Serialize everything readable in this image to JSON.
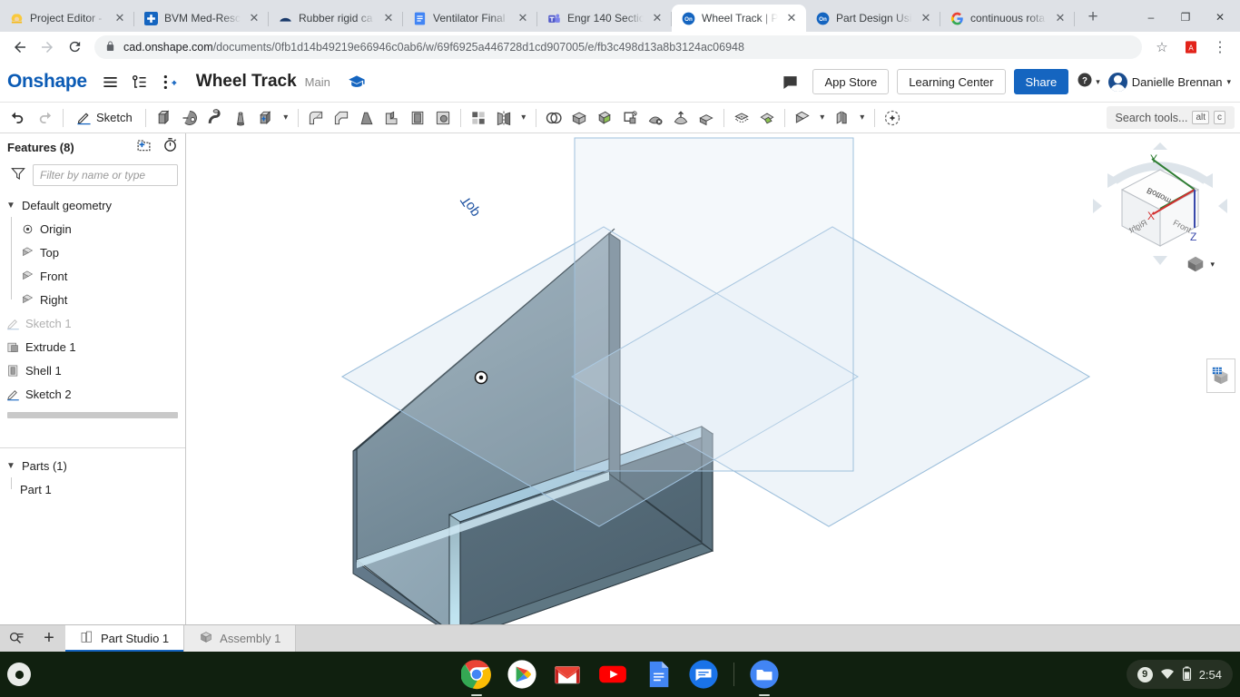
{
  "browser": {
    "tabs": [
      {
        "title": "Project Editor -",
        "favicon": "construction-worker-icon",
        "active": false
      },
      {
        "title": "BVM Med-Rescu",
        "favicon": "blue-plus-icon",
        "active": false
      },
      {
        "title": "Rubber rigid ca",
        "favicon": "dark-blue-shape-icon",
        "active": false
      },
      {
        "title": "Ventilator Final",
        "favicon": "google-docs-icon",
        "active": false
      },
      {
        "title": "Engr 140 Sectio",
        "favicon": "microsoft-teams-icon",
        "active": false
      },
      {
        "title": "Wheel Track | P",
        "favicon": "onshape-icon",
        "active": true
      },
      {
        "title": "Part Design Usi",
        "favicon": "onshape-icon",
        "active": false
      },
      {
        "title": "continuous rota",
        "favicon": "google-icon",
        "active": false
      }
    ],
    "new_tab_label": "+",
    "close_label": "✕",
    "window_controls": {
      "minimize": "–",
      "maximize": "❐",
      "close": "✕"
    },
    "nav": {
      "back": "←",
      "forward": "→",
      "reload": "⟳"
    },
    "url_host": "cad.onshape.com",
    "url_path": "/documents/0fb1d14b49219e66946c0ab6/w/69f6925a446728d1cd907005/e/fb3c498d13a8b3124ac06948",
    "lock_icon": "lock-icon",
    "star_icon": "☆",
    "pdf_icon": "A",
    "menu_icon": "⋮"
  },
  "onshape_header": {
    "logo": "Onshape",
    "menu_icon": "hamburger-menu-icon",
    "versions_icon": "version-graph-icon",
    "insert_icon": "branch-add-icon",
    "document_title": "Wheel Track",
    "branch": "Main",
    "graduation_icon": "graduation-cap-icon",
    "comment_icon": "comment-bubble-icon",
    "app_store_label": "App Store",
    "learning_center_label": "Learning Center",
    "share_label": "Share",
    "help_icon": "question-circle-icon",
    "caret": "▾",
    "user_name": "Danielle Brennan"
  },
  "toolbar": {
    "undo": "undo-arrow-icon",
    "redo": "redo-arrow-icon",
    "sketch_label": "Sketch",
    "tools": [
      "extrude-icon",
      "revolve-icon",
      "sweep-icon",
      "loft-icon",
      "thicken-icon",
      "fillet-icon",
      "chamfer-icon",
      "draft-icon",
      "rib-icon",
      "shell-icon",
      "hole-icon",
      "linear-pattern-icon",
      "mirror-icon",
      "boolean-icon",
      "enclose-icon",
      "split-icon",
      "transform-icon",
      "delete-face-icon",
      "move-face-icon",
      "delete-part-icon",
      "offset-surface-icon",
      "fill-surface-icon",
      "plane-icon",
      "sheet-metal-icon",
      "variable-icon"
    ],
    "search_placeholder": "Search tools...",
    "kbd_alt": "alt",
    "kbd_c": "c"
  },
  "features_panel": {
    "title": "Features (8)",
    "add_folder_icon": "add-folder-icon",
    "history_icon": "stopwatch-icon",
    "filter_icon": "funnel-icon",
    "filter_placeholder": "Filter by name or type",
    "default_geometry_label": "Default geometry",
    "default_geometry_items": [
      {
        "label": "Origin",
        "icon": "origin-point-icon"
      },
      {
        "label": "Top",
        "icon": "plane-icon"
      },
      {
        "label": "Front",
        "icon": "plane-icon"
      },
      {
        "label": "Right",
        "icon": "plane-icon"
      }
    ],
    "features": [
      {
        "label": "Sketch 1",
        "icon": "sketch-icon",
        "muted": true
      },
      {
        "label": "Extrude 1",
        "icon": "extrude-icon",
        "muted": false
      },
      {
        "label": "Shell 1",
        "icon": "shell-icon",
        "muted": false
      },
      {
        "label": "Sketch 2",
        "icon": "sketch-icon",
        "muted": false
      }
    ],
    "parts_label": "Parts (1)",
    "parts": [
      {
        "label": "Part 1"
      }
    ],
    "rollback_toolbar_icon": "feature-list-icon"
  },
  "viewport": {
    "plane_label_top": "Top",
    "origin_marker": "origin-point-icon",
    "view_cube": {
      "faces": [
        "Bottom",
        "Right",
        "Front"
      ],
      "axes": [
        {
          "name": "X",
          "color": "#d32f2f"
        },
        {
          "name": "Y",
          "color": "#2e7d32"
        },
        {
          "name": "Z",
          "color": "#3949ab"
        }
      ]
    },
    "display_mode_icon": "shaded-cube-icon",
    "display_mode_caret": "▾",
    "appearance_icon": "appearance-panel-icon",
    "colors": {
      "part_face_light": "#8fa3af",
      "part_face_mid": "#7d919e",
      "part_face_dark": "#5c7280",
      "part_edge": "#2f3d45",
      "plane_fill": "#e8f0f8",
      "plane_edge": "#9bb7d4",
      "plane_label": "#1a4fa0"
    }
  },
  "bottom_tabs": {
    "search_icon": "element-search-icon",
    "add_icon": "+",
    "tabs": [
      {
        "label": "Part Studio 1",
        "icon": "part-studio-icon",
        "active": true
      },
      {
        "label": "Assembly 1",
        "icon": "assembly-icon",
        "active": false
      }
    ]
  },
  "shelf": {
    "launcher_icon": "launcher-circle-icon",
    "apps": [
      {
        "name": "chrome-icon",
        "running": true
      },
      {
        "name": "play-store-icon",
        "running": false
      },
      {
        "name": "gmail-icon",
        "running": false
      },
      {
        "name": "youtube-icon",
        "running": false
      },
      {
        "name": "google-docs-icon",
        "running": false
      },
      {
        "name": "messages-icon",
        "running": false
      },
      {
        "name": "files-icon",
        "running": true
      }
    ],
    "tray": {
      "notification_count": "9",
      "wifi_icon": "wifi-icon",
      "battery_icon": "battery-icon",
      "time": "2:54"
    }
  }
}
